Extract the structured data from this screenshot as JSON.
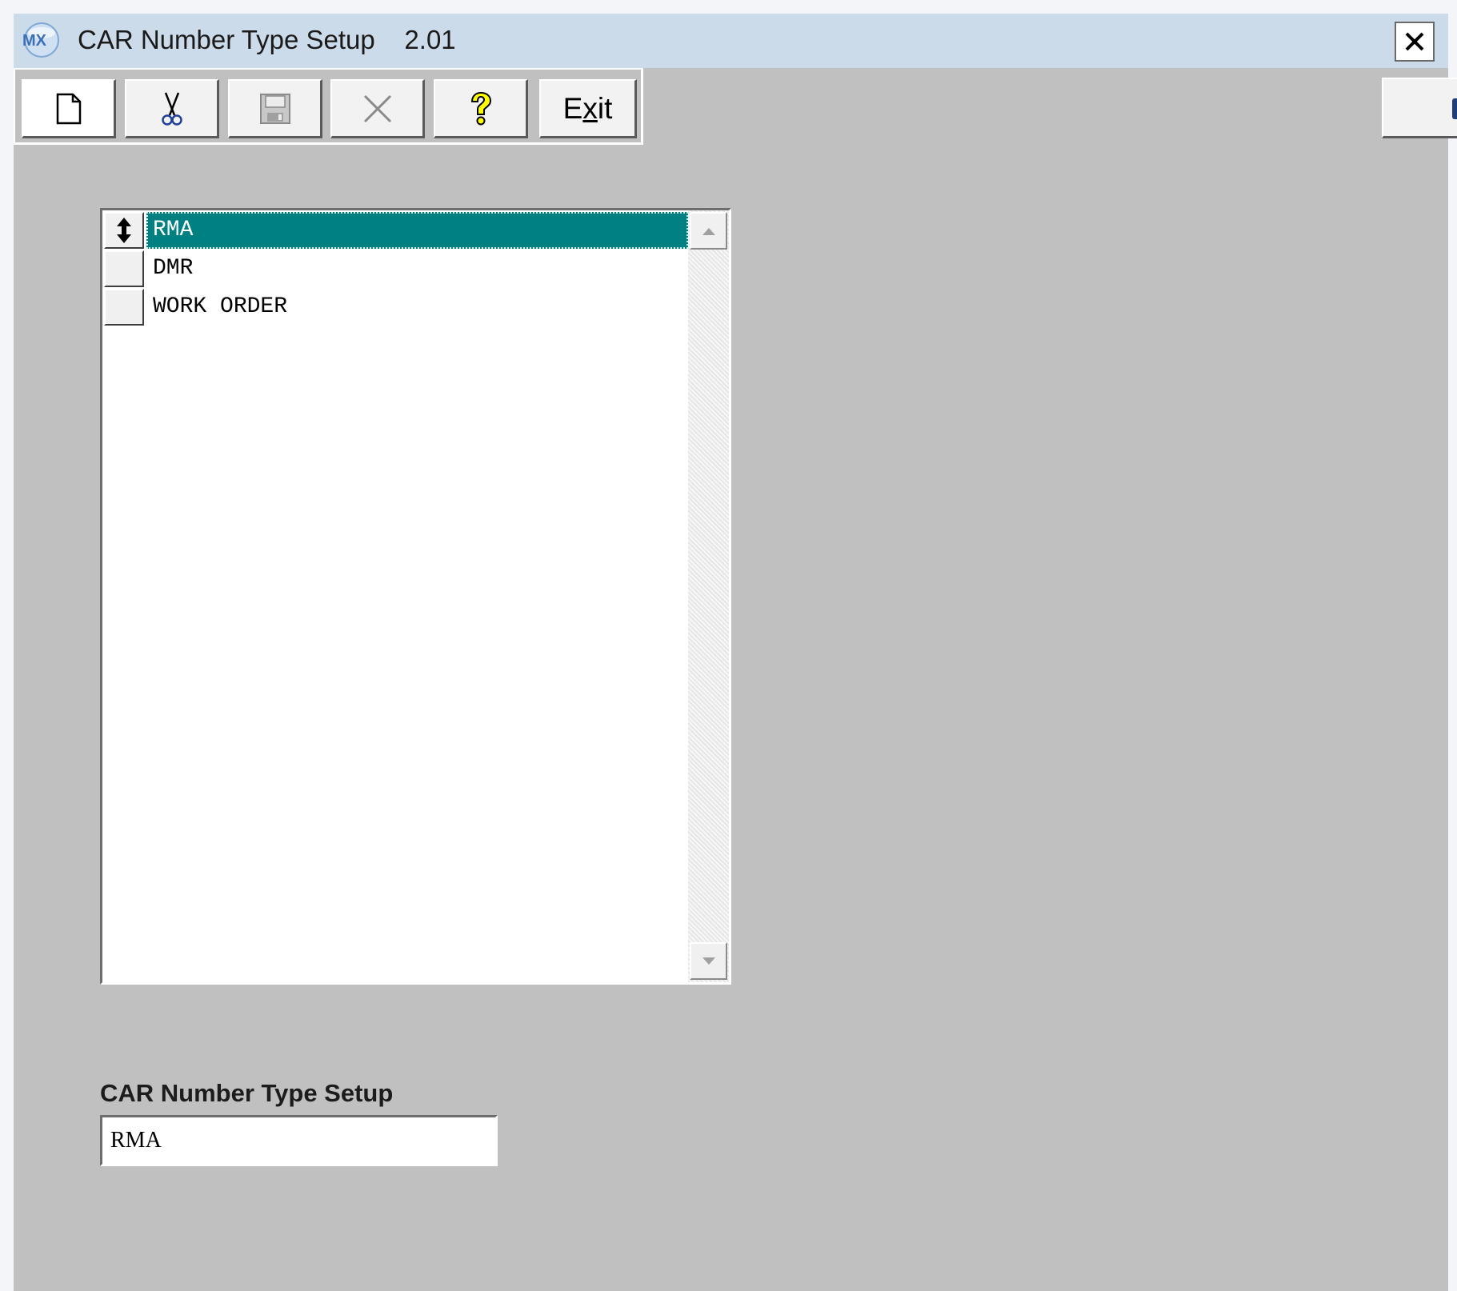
{
  "window": {
    "title": "CAR Number Type Setup",
    "version": "2.01",
    "logo_text": "MX"
  },
  "toolbar": {
    "buttons": [
      {
        "icon": "new-document-icon",
        "enabled": true
      },
      {
        "icon": "cut-icon",
        "enabled": true
      },
      {
        "icon": "save-icon",
        "enabled": false
      },
      {
        "icon": "delete-icon",
        "enabled": false
      },
      {
        "icon": "help-icon",
        "enabled": true
      }
    ],
    "exit_label_prefix": "E",
    "exit_label_underlined": "x",
    "exit_label_suffix": "it"
  },
  "grid": {
    "rows": [
      {
        "value": "RMA",
        "selected": true
      },
      {
        "value": "DMR",
        "selected": false
      },
      {
        "value": "WORK ORDER",
        "selected": false
      }
    ]
  },
  "detail": {
    "label": "CAR Number Type Setup",
    "value": "RMA"
  },
  "colors": {
    "selection": "#008080",
    "background": "#c0c0c0",
    "titlebar": "#ccdbe9"
  }
}
